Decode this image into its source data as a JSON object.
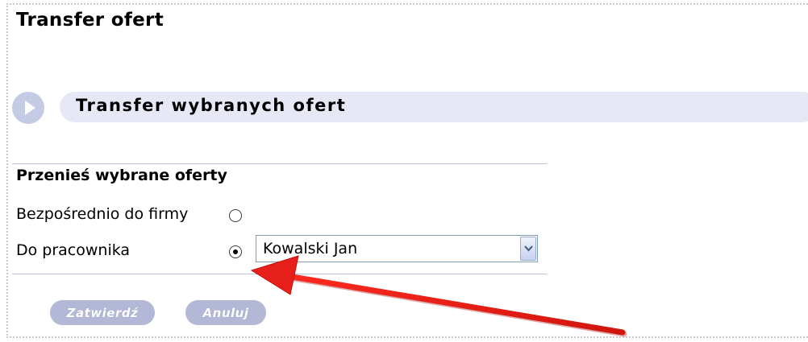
{
  "page": {
    "title": "Transfer ofert"
  },
  "section": {
    "title": "Transfer wybranych ofert"
  },
  "form": {
    "heading": "Przenieś wybrane oferty",
    "option_direct": {
      "label": "Bezpośrednio do firmy",
      "checked": false
    },
    "option_employee": {
      "label": "Do pracownika",
      "checked": true
    },
    "employee_select": {
      "value": "Kowalski Jan"
    }
  },
  "buttons": {
    "confirm_label": "Zatwierdź",
    "cancel_label": "Anuluj"
  },
  "colors": {
    "section_bar": "#e6e9f5",
    "section_icon": "#c5cbe4",
    "button_fill": "#b3b8d6",
    "annotation_arrow": "#e8201c"
  },
  "icons": {
    "section_icon": "play-circle-icon",
    "select_icon": "chevron-down-icon",
    "annotation": "red-arrow-annotation"
  }
}
